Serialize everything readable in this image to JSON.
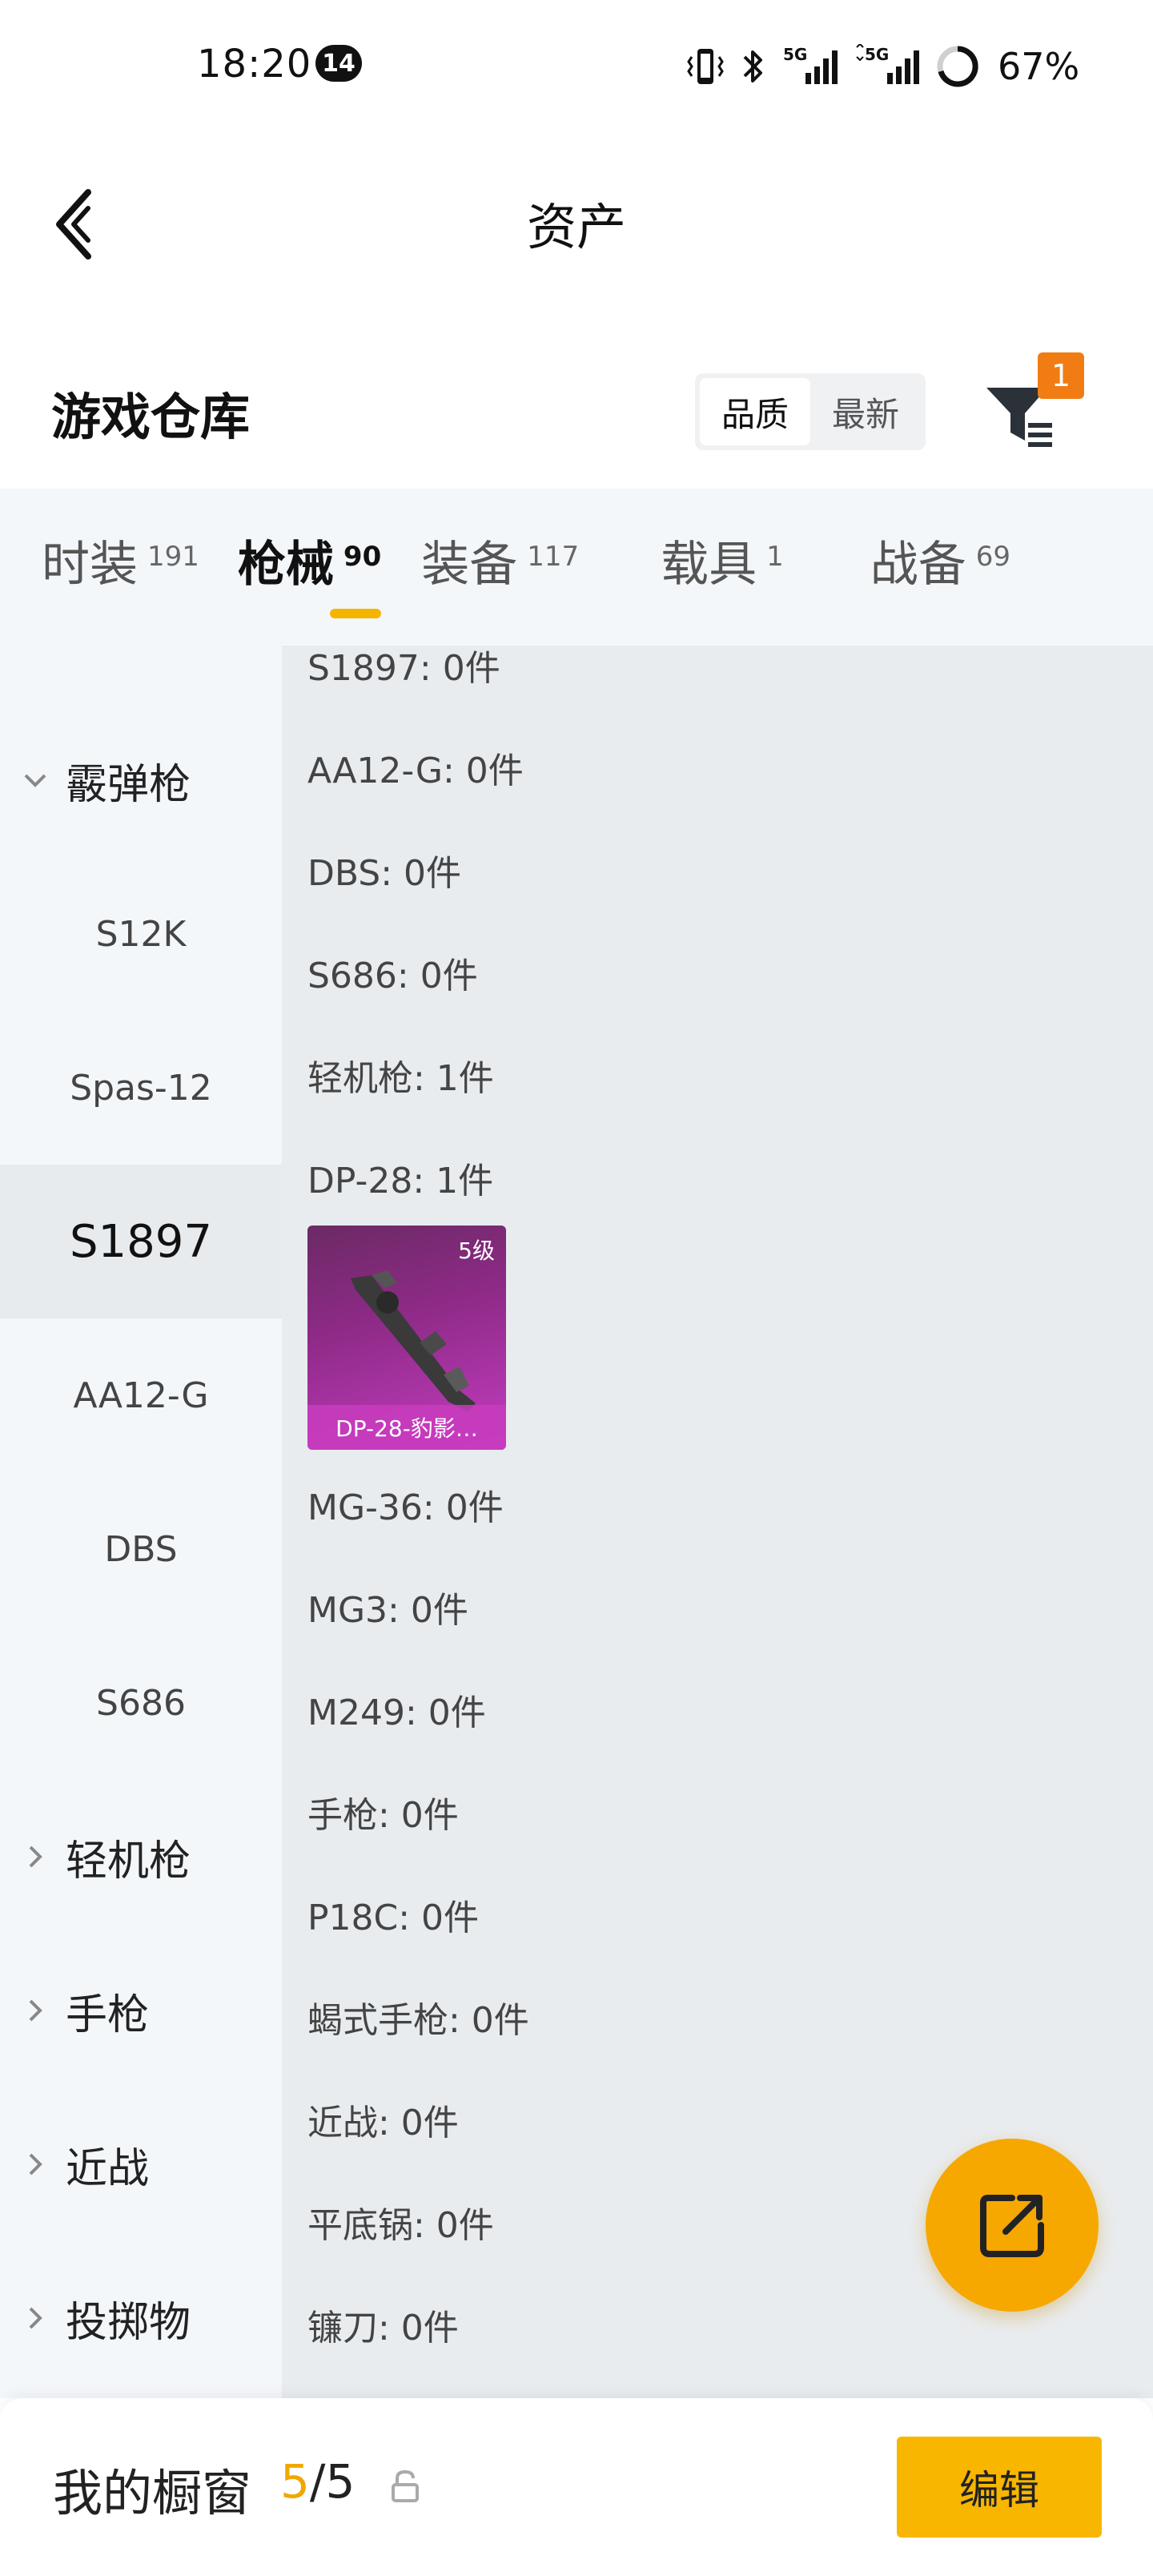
{
  "status_bar": {
    "time": "18:20",
    "notification_count": "14",
    "battery": "67%"
  },
  "header": {
    "title": "资产"
  },
  "warehouse": {
    "title": "游戏仓库",
    "sort_options": [
      "品质",
      "最新"
    ],
    "active_sort": "品质",
    "filter_badge": "1"
  },
  "tabs": [
    {
      "label": "时装",
      "count": "191"
    },
    {
      "label": "枪械",
      "count": "90",
      "active": true
    },
    {
      "label": "装备",
      "count": "117"
    },
    {
      "label": "载具",
      "count": "1"
    },
    {
      "label": "战备",
      "count": "69"
    }
  ],
  "side_nav": {
    "items": [
      {
        "label": "霰弹枪",
        "type": "group",
        "expanded": true
      },
      {
        "label": "S12K",
        "type": "item"
      },
      {
        "label": "Spas-12",
        "type": "item"
      },
      {
        "label": "S1897",
        "type": "item",
        "selected": true
      },
      {
        "label": "AA12-G",
        "type": "item"
      },
      {
        "label": "DBS",
        "type": "item"
      },
      {
        "label": "S686",
        "type": "item"
      },
      {
        "label": "轻机枪",
        "type": "group",
        "expanded": false
      },
      {
        "label": "手枪",
        "type": "group",
        "expanded": false
      },
      {
        "label": "近战",
        "type": "group",
        "expanded": false
      },
      {
        "label": "投掷物",
        "type": "group",
        "expanded": false
      }
    ]
  },
  "content": {
    "rows": [
      {
        "label": "S1897: 0件"
      },
      {
        "label": "AA12-G: 0件"
      },
      {
        "label": "DBS: 0件"
      },
      {
        "label": "S686: 0件"
      },
      {
        "label": "轻机枪: 1件"
      },
      {
        "label": "DP-28: 1件"
      },
      {
        "label": "MG-36: 0件"
      },
      {
        "label": "MG3: 0件"
      },
      {
        "label": "M249: 0件"
      },
      {
        "label": "手枪: 0件"
      },
      {
        "label": "P18C: 0件"
      },
      {
        "label": "蝎式手枪: 0件"
      },
      {
        "label": "近战: 0件"
      },
      {
        "label": "平底锅: 0件"
      },
      {
        "label": "镰刀: 0件"
      }
    ],
    "item_card": {
      "level": "5级",
      "name": "DP-28-豹影…"
    }
  },
  "bottom_bar": {
    "label": "我的橱窗",
    "current": "5",
    "separator": "/",
    "total": "5",
    "edit_label": "编辑"
  }
}
